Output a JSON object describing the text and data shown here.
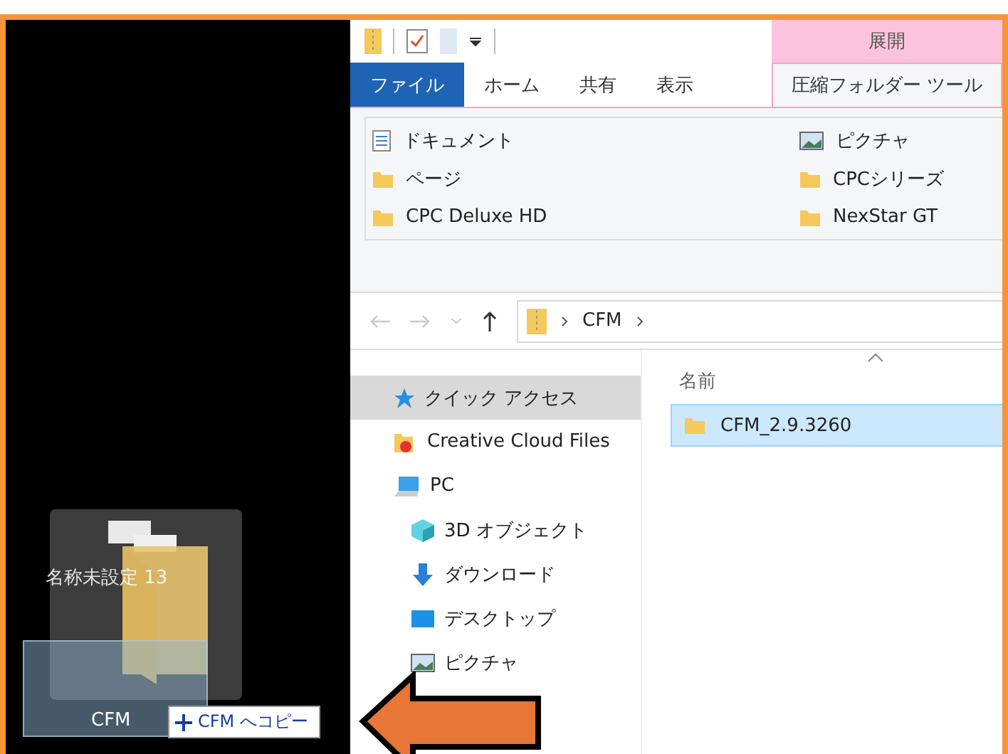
{
  "desktop": {
    "icons": [
      {
        "label": "名称未設定 13",
        "kind": "drag"
      },
      {
        "label": "CFM",
        "kind": "target"
      }
    ],
    "drag_tooltip": "CFM へコピー"
  },
  "explorer": {
    "context_header": "展開",
    "tabs": [
      {
        "label": "ファイル",
        "kind": "file",
        "selected": false
      },
      {
        "label": "ホーム",
        "kind": "tab",
        "selected": false
      },
      {
        "label": "共有",
        "kind": "tab",
        "selected": false
      },
      {
        "label": "表示",
        "kind": "tab",
        "selected": false
      },
      {
        "label": "圧縮フォルダー ツール",
        "kind": "tab",
        "selected": true
      }
    ],
    "ribbon_items": [
      {
        "label": "ドキュメント",
        "kind": "document"
      },
      {
        "label": "ページ",
        "kind": "folder"
      },
      {
        "label": "CPC Deluxe HD",
        "kind": "folder"
      },
      {
        "label": "ピクチャ",
        "kind": "picture"
      },
      {
        "label": "CPCシリーズ",
        "kind": "folder"
      },
      {
        "label": "NexStar GT",
        "kind": "folder"
      }
    ],
    "address": {
      "path": "CFM"
    },
    "nav": [
      {
        "label": "クイック アクセス",
        "kind": "star",
        "selected": true
      },
      {
        "label": "Creative Cloud Files",
        "kind": "cloud",
        "selected": false
      },
      {
        "label": "PC",
        "kind": "pc",
        "selected": false,
        "children": [
          {
            "label": "3D オブジェクト",
            "kind": "cube",
            "selected": false
          },
          {
            "label": "ダウンロード",
            "kind": "download",
            "selected": false
          },
          {
            "label": "デスクトップ",
            "kind": "desktop",
            "selected": false
          },
          {
            "label": "ピクチャ",
            "kind": "picture",
            "selected": false
          }
        ]
      }
    ],
    "column": "名前",
    "files": [
      {
        "name": "CFM_2.9.3260",
        "selected": true
      }
    ]
  }
}
